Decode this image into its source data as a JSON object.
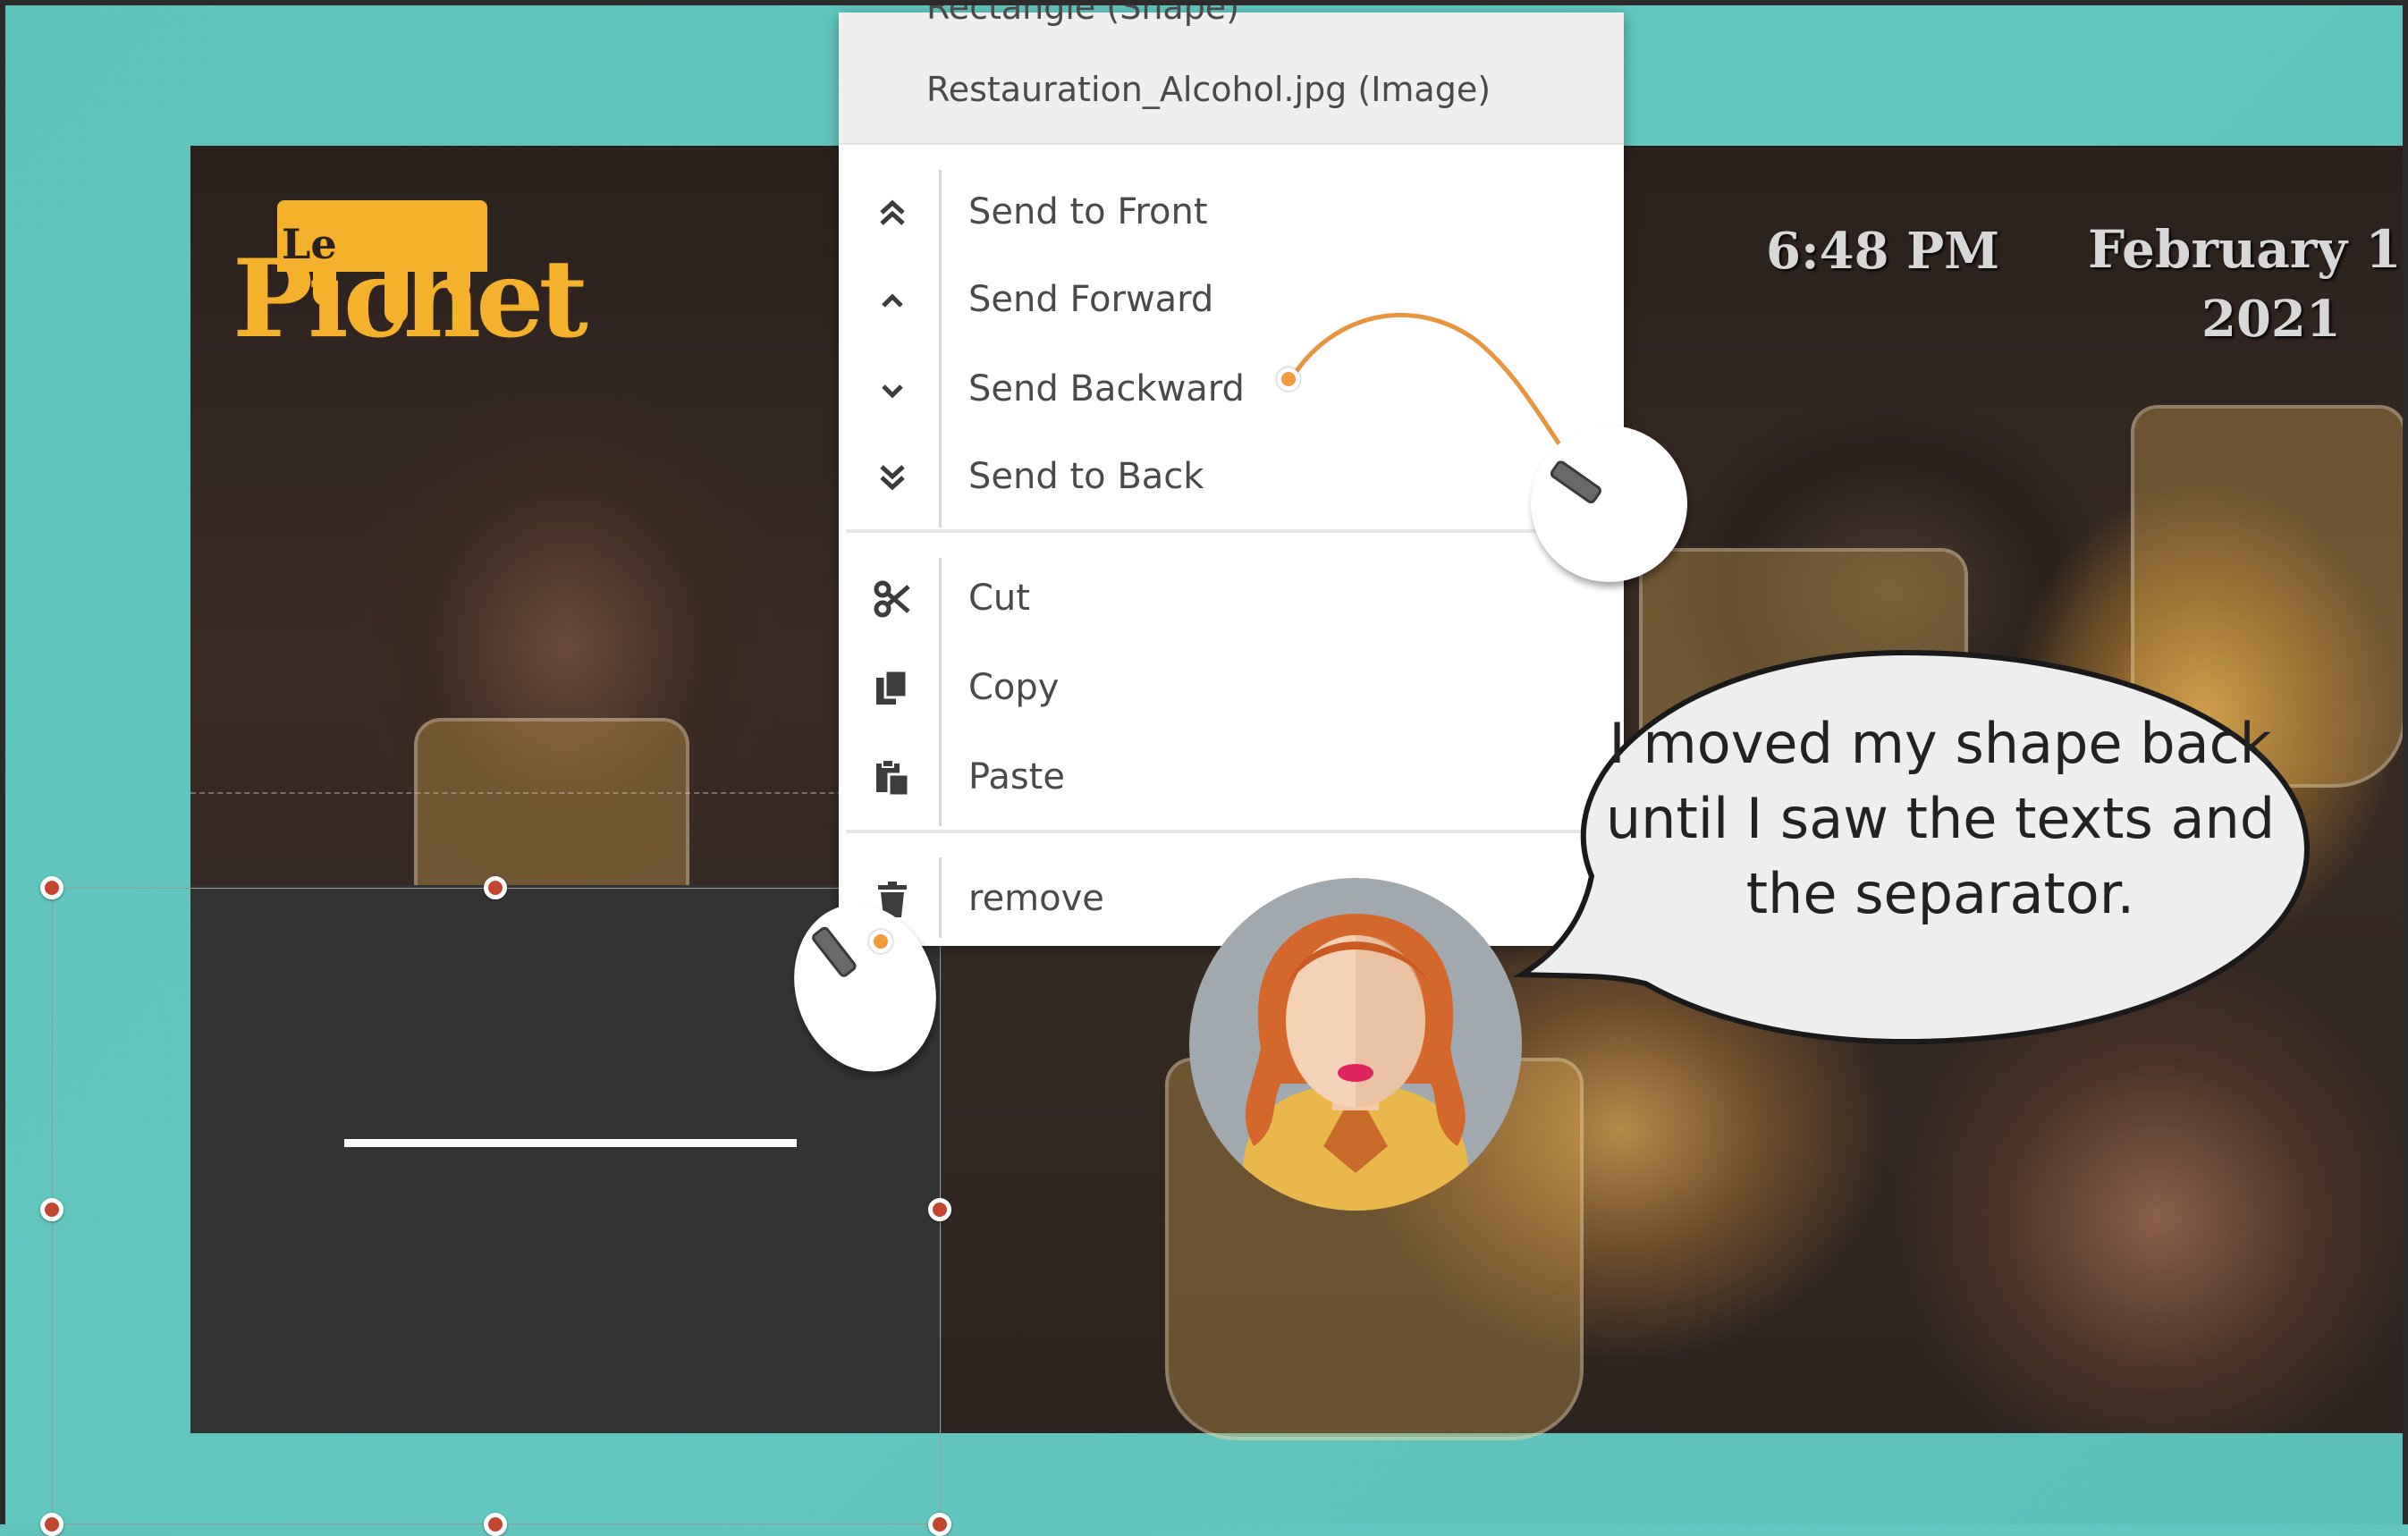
{
  "slide": {
    "logo_text": "Pichet",
    "logo_prefix": "Le",
    "time": "6:48 PM",
    "date": "February 1:",
    "year": "2021"
  },
  "context_menu": {
    "header_prev": "Rectangle (Shape)",
    "header_current": "Restauration_Alcohol.jpg (Image)",
    "items": [
      {
        "label": "Send to Front",
        "icon": "chevrons-up-icon"
      },
      {
        "label": "Send Forward",
        "icon": "chevron-up-icon"
      },
      {
        "label": "Send Backward",
        "icon": "chevron-down-icon"
      },
      {
        "label": "Send to Back",
        "icon": "chevrons-down-icon"
      },
      {
        "label": "Cut",
        "icon": "scissors-icon"
      },
      {
        "label": "Copy",
        "icon": "copy-icon"
      },
      {
        "label": "Paste",
        "icon": "paste-icon"
      },
      {
        "label": "remove",
        "icon": "trash-icon"
      }
    ]
  },
  "callout": {
    "text": "I moved my shape back until I saw the texts and the separator."
  },
  "colors": {
    "background": "#5fc3bc",
    "selection_handle": "#c4452e",
    "click_marker": "#f29a3c",
    "logo": "#f4b12c",
    "shape": "#333333"
  }
}
